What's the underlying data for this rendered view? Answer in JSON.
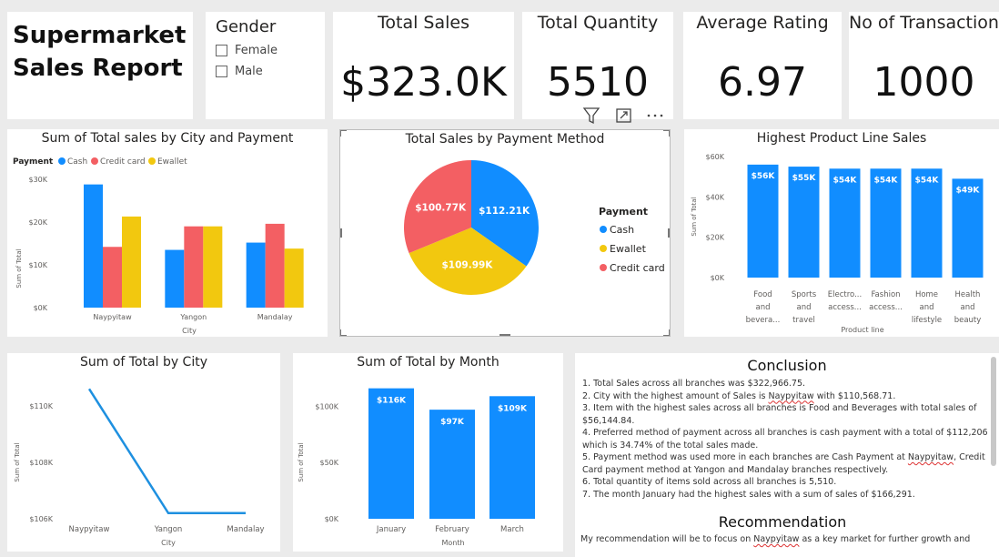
{
  "report_title": [
    "Supermarket",
    "Sales Report"
  ],
  "gender_slicer": {
    "title": "Gender",
    "options": [
      "Female",
      "Male"
    ]
  },
  "kpis": [
    {
      "label": "Total Sales",
      "value": "$323.0K"
    },
    {
      "label": "Total Quantity",
      "value": "5510"
    },
    {
      "label": "Average Rating",
      "value": "6.97"
    },
    {
      "label": "No of Transaction",
      "value": "1000"
    }
  ],
  "visual_header_icons": [
    "filter-icon",
    "focus-mode-icon",
    "more-options-icon"
  ],
  "colors": {
    "cash": "#118DFF",
    "credit_card": "#F35F63",
    "ewallet": "#F2C80F",
    "bar": "#118DFF",
    "line": "#1E90E0"
  },
  "chart_data": [
    {
      "type": "bar",
      "title": "Sum of Total sales by City and Payment",
      "legend_title": "Payment",
      "categories": [
        "Naypyitaw",
        "Yangon",
        "Mandalay"
      ],
      "series": [
        {
          "name": "Cash",
          "values": [
            28.8,
            13.5,
            15.2
          ]
        },
        {
          "name": "Credit card",
          "values": [
            14.2,
            19.0,
            19.6
          ]
        },
        {
          "name": "Ewallet",
          "values": [
            21.3,
            19.0,
            13.8
          ]
        }
      ],
      "yticks": [
        "$0K",
        "$10K",
        "$20K",
        "$30K"
      ],
      "ylim": [
        0,
        30
      ],
      "xlabel": "City",
      "ylabel": "Sum of Total",
      "legend_placement": "top-left"
    },
    {
      "type": "pie",
      "title": "Total Sales by Payment Method",
      "legend_title": "Payment",
      "slices": [
        {
          "name": "Cash",
          "value": 112.21,
          "label": "$112.21K"
        },
        {
          "name": "Ewallet",
          "value": 109.99,
          "label": "$109.99K"
        },
        {
          "name": "Credit card",
          "value": 100.77,
          "label": "$100.77K"
        }
      ],
      "legend_placement": "right"
    },
    {
      "type": "bar",
      "title": "Highest Product Line Sales",
      "categories": [
        [
          "Food",
          "and",
          "bevera..."
        ],
        [
          "Sports",
          "and",
          "travel"
        ],
        [
          "Electro...",
          "access..."
        ],
        [
          "Fashion",
          "access..."
        ],
        [
          "Home",
          "and",
          "lifestyle"
        ],
        [
          "Health",
          "and",
          "beauty"
        ]
      ],
      "values": [
        56,
        55,
        54,
        54,
        54,
        49
      ],
      "data_labels": [
        "$56K",
        "$55K",
        "$54K",
        "$54K",
        "$54K",
        "$49K"
      ],
      "yticks": [
        "$0K",
        "$20K",
        "$40K",
        "$60K"
      ],
      "ylim": [
        0,
        60
      ],
      "xlabel": "Product line",
      "ylabel": "Sum of Total"
    },
    {
      "type": "line",
      "title": "Sum of Total by City",
      "categories": [
        "Naypyitaw",
        "Yangon",
        "Mandalay"
      ],
      "values": [
        110.6,
        106.2,
        106.2
      ],
      "yticks": [
        "$106K",
        "$108K",
        "$110K"
      ],
      "ylim": [
        106,
        110.9
      ],
      "xlabel": "City",
      "ylabel": "Sum of Total"
    },
    {
      "type": "bar",
      "title": "Sum of Total by Month",
      "categories": [
        "January",
        "February",
        "March"
      ],
      "values": [
        116,
        97,
        109
      ],
      "data_labels": [
        "$116K",
        "$97K",
        "$109K"
      ],
      "yticks": [
        "$0K",
        "$50K",
        "$100K"
      ],
      "ylim": [
        0,
        123
      ],
      "xlabel": "Month",
      "ylabel": "Sum of Total"
    }
  ],
  "conclusion": {
    "title": "Conclusion",
    "items": [
      [
        "1. Total Sales across all branches was $322,966.75."
      ],
      [
        "2. City with the highest amount of Sales is ",
        {
          "sq": "Naypyitaw"
        },
        " with $110,568.71."
      ],
      [
        "3. Item with the highest sales across all branches is Food and Beverages with total sales of $56,144.84."
      ],
      [
        "4. Preferred method of payment across all branches is cash payment with a total of $112,206 which is 34.74% of the total sales made."
      ],
      [
        "5. Payment method was used more in each branches are Cash Payment at ",
        {
          "sq": "Naypyitaw"
        },
        ", Credit Card payment method at Yangon and Mandalay branches respectively."
      ],
      [
        "6. Total quantity of items sold across all branches is 5,510."
      ],
      [
        "7. The month January had the highest sales with a sum of sales of $166,291."
      ]
    ]
  },
  "recommendation": {
    "title": "Recommendation",
    "text": [
      "My recommendation will be to focus on ",
      {
        "sq": "Naypyitaw"
      },
      " as a key market for further growth and"
    ]
  }
}
